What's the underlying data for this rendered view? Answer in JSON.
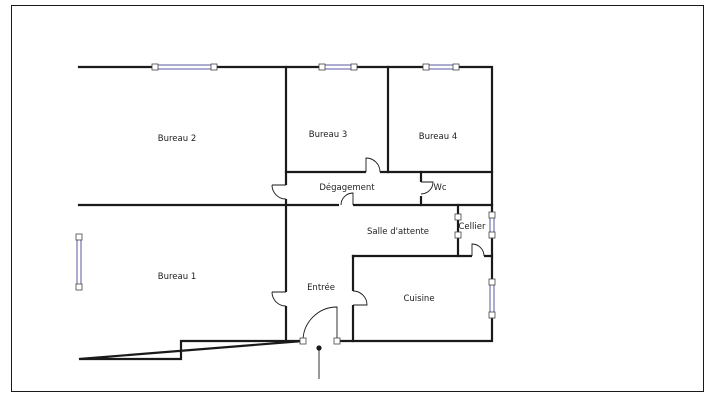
{
  "plan": {
    "rooms": {
      "bureau_2": "Bureau 2",
      "bureau_3": "Bureau 3",
      "bureau_4": "Bureau 4",
      "degagement": "Dégagement",
      "wc": "Wc",
      "salle_attente": "Salle d'attente",
      "cellier": "Cellier",
      "bureau_1": "Bureau 1",
      "entree": "Entrée",
      "cuisine": "Cuisine"
    },
    "colors": {
      "wall": "#1a1a1a",
      "window": "#5a5aa0",
      "background": "#ffffff"
    }
  }
}
